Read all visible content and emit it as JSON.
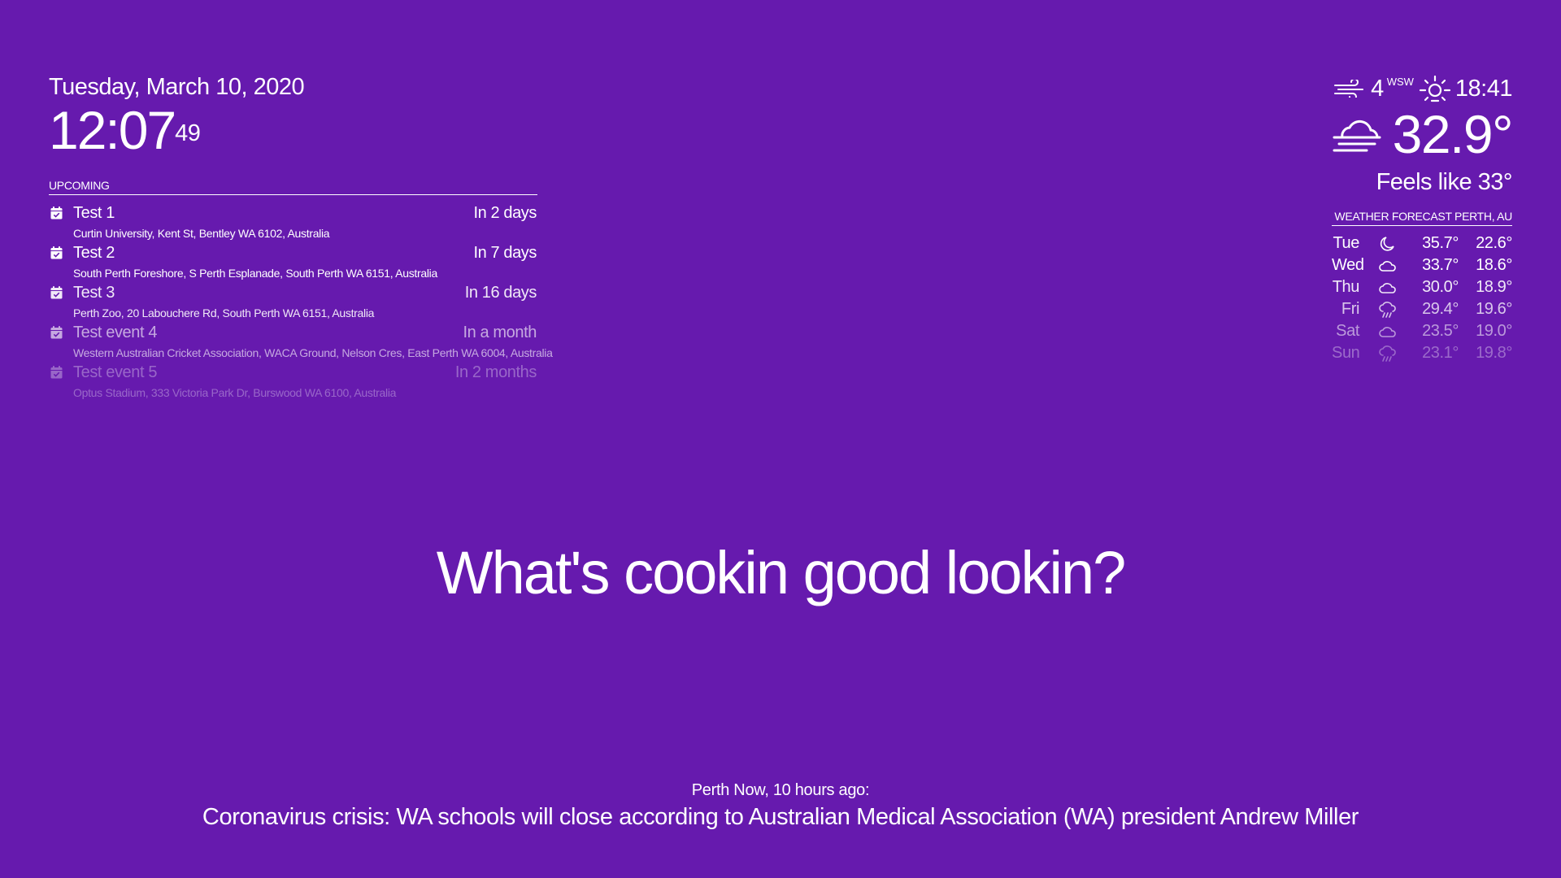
{
  "clock": {
    "date": "Tuesday, March 10, 2020",
    "time": "12:07",
    "seconds": "49"
  },
  "calendar": {
    "header": "UPCOMING",
    "events": [
      {
        "title": "Test 1",
        "when": "In 2 days",
        "location": "Curtin University, Kent St, Bentley WA 6102, Australia",
        "opacity": 1.0
      },
      {
        "title": "Test 2",
        "when": "In 7 days",
        "location": "South Perth Foreshore, S Perth Esplanade, South Perth WA 6151, Australia",
        "opacity": 1.0
      },
      {
        "title": "Test 3",
        "when": "In 16 days",
        "location": "Perth Zoo, 20 Labouchere Rd, South Perth WA 6151, Australia",
        "opacity": 0.9
      },
      {
        "title": "Test event 4",
        "when": "In a month",
        "location": "Western Australian Cricket Association, WACA Ground, Nelson Cres, East Perth WA 6004, Australia",
        "opacity": 0.62
      },
      {
        "title": "Test event 5",
        "when": "In 2 months",
        "location": "Optus Stadium, 333 Victoria Park Dr, Burswood WA 6100, Australia",
        "opacity": 0.33
      }
    ]
  },
  "current_weather": {
    "wind_icon": "wind-icon",
    "wind_speed": "4",
    "wind_direction": "WSW",
    "sun_icon": "sunset-icon",
    "sunset_time": "18:41",
    "condition_icon": "cloudy-windy-icon",
    "temperature": "32.9°",
    "feels_like": "Feels like 33°"
  },
  "forecast": {
    "header": "WEATHER FORECAST PERTH, AU",
    "days": [
      {
        "day": "Tue",
        "icon": "moon-icon",
        "max": "35.7°",
        "min": "22.6°",
        "opacity": 1.0
      },
      {
        "day": "Wed",
        "icon": "cloud-icon",
        "max": "33.7°",
        "min": "18.6°",
        "opacity": 1.0
      },
      {
        "day": "Thu",
        "icon": "cloud-icon",
        "max": "30.0°",
        "min": "18.9°",
        "opacity": 0.9
      },
      {
        "day": "Fri",
        "icon": "rain-icon",
        "max": "29.4°",
        "min": "19.6°",
        "opacity": 0.75
      },
      {
        "day": "Sat",
        "icon": "cloud-icon",
        "max": "23.5°",
        "min": "19.0°",
        "opacity": 0.55
      },
      {
        "day": "Sun",
        "icon": "rain-icon",
        "max": "23.1°",
        "min": "19.8°",
        "opacity": 0.35
      }
    ]
  },
  "compliment": "What's cookin good lookin?",
  "news": {
    "source": "Perth Now, 10 hours ago:",
    "headline": "Coronavirus crisis: WA schools will close according to Australian Medical Association (WA) president Andrew Miller"
  },
  "colors": {
    "background": "#661aae",
    "foreground": "#ffffff"
  }
}
